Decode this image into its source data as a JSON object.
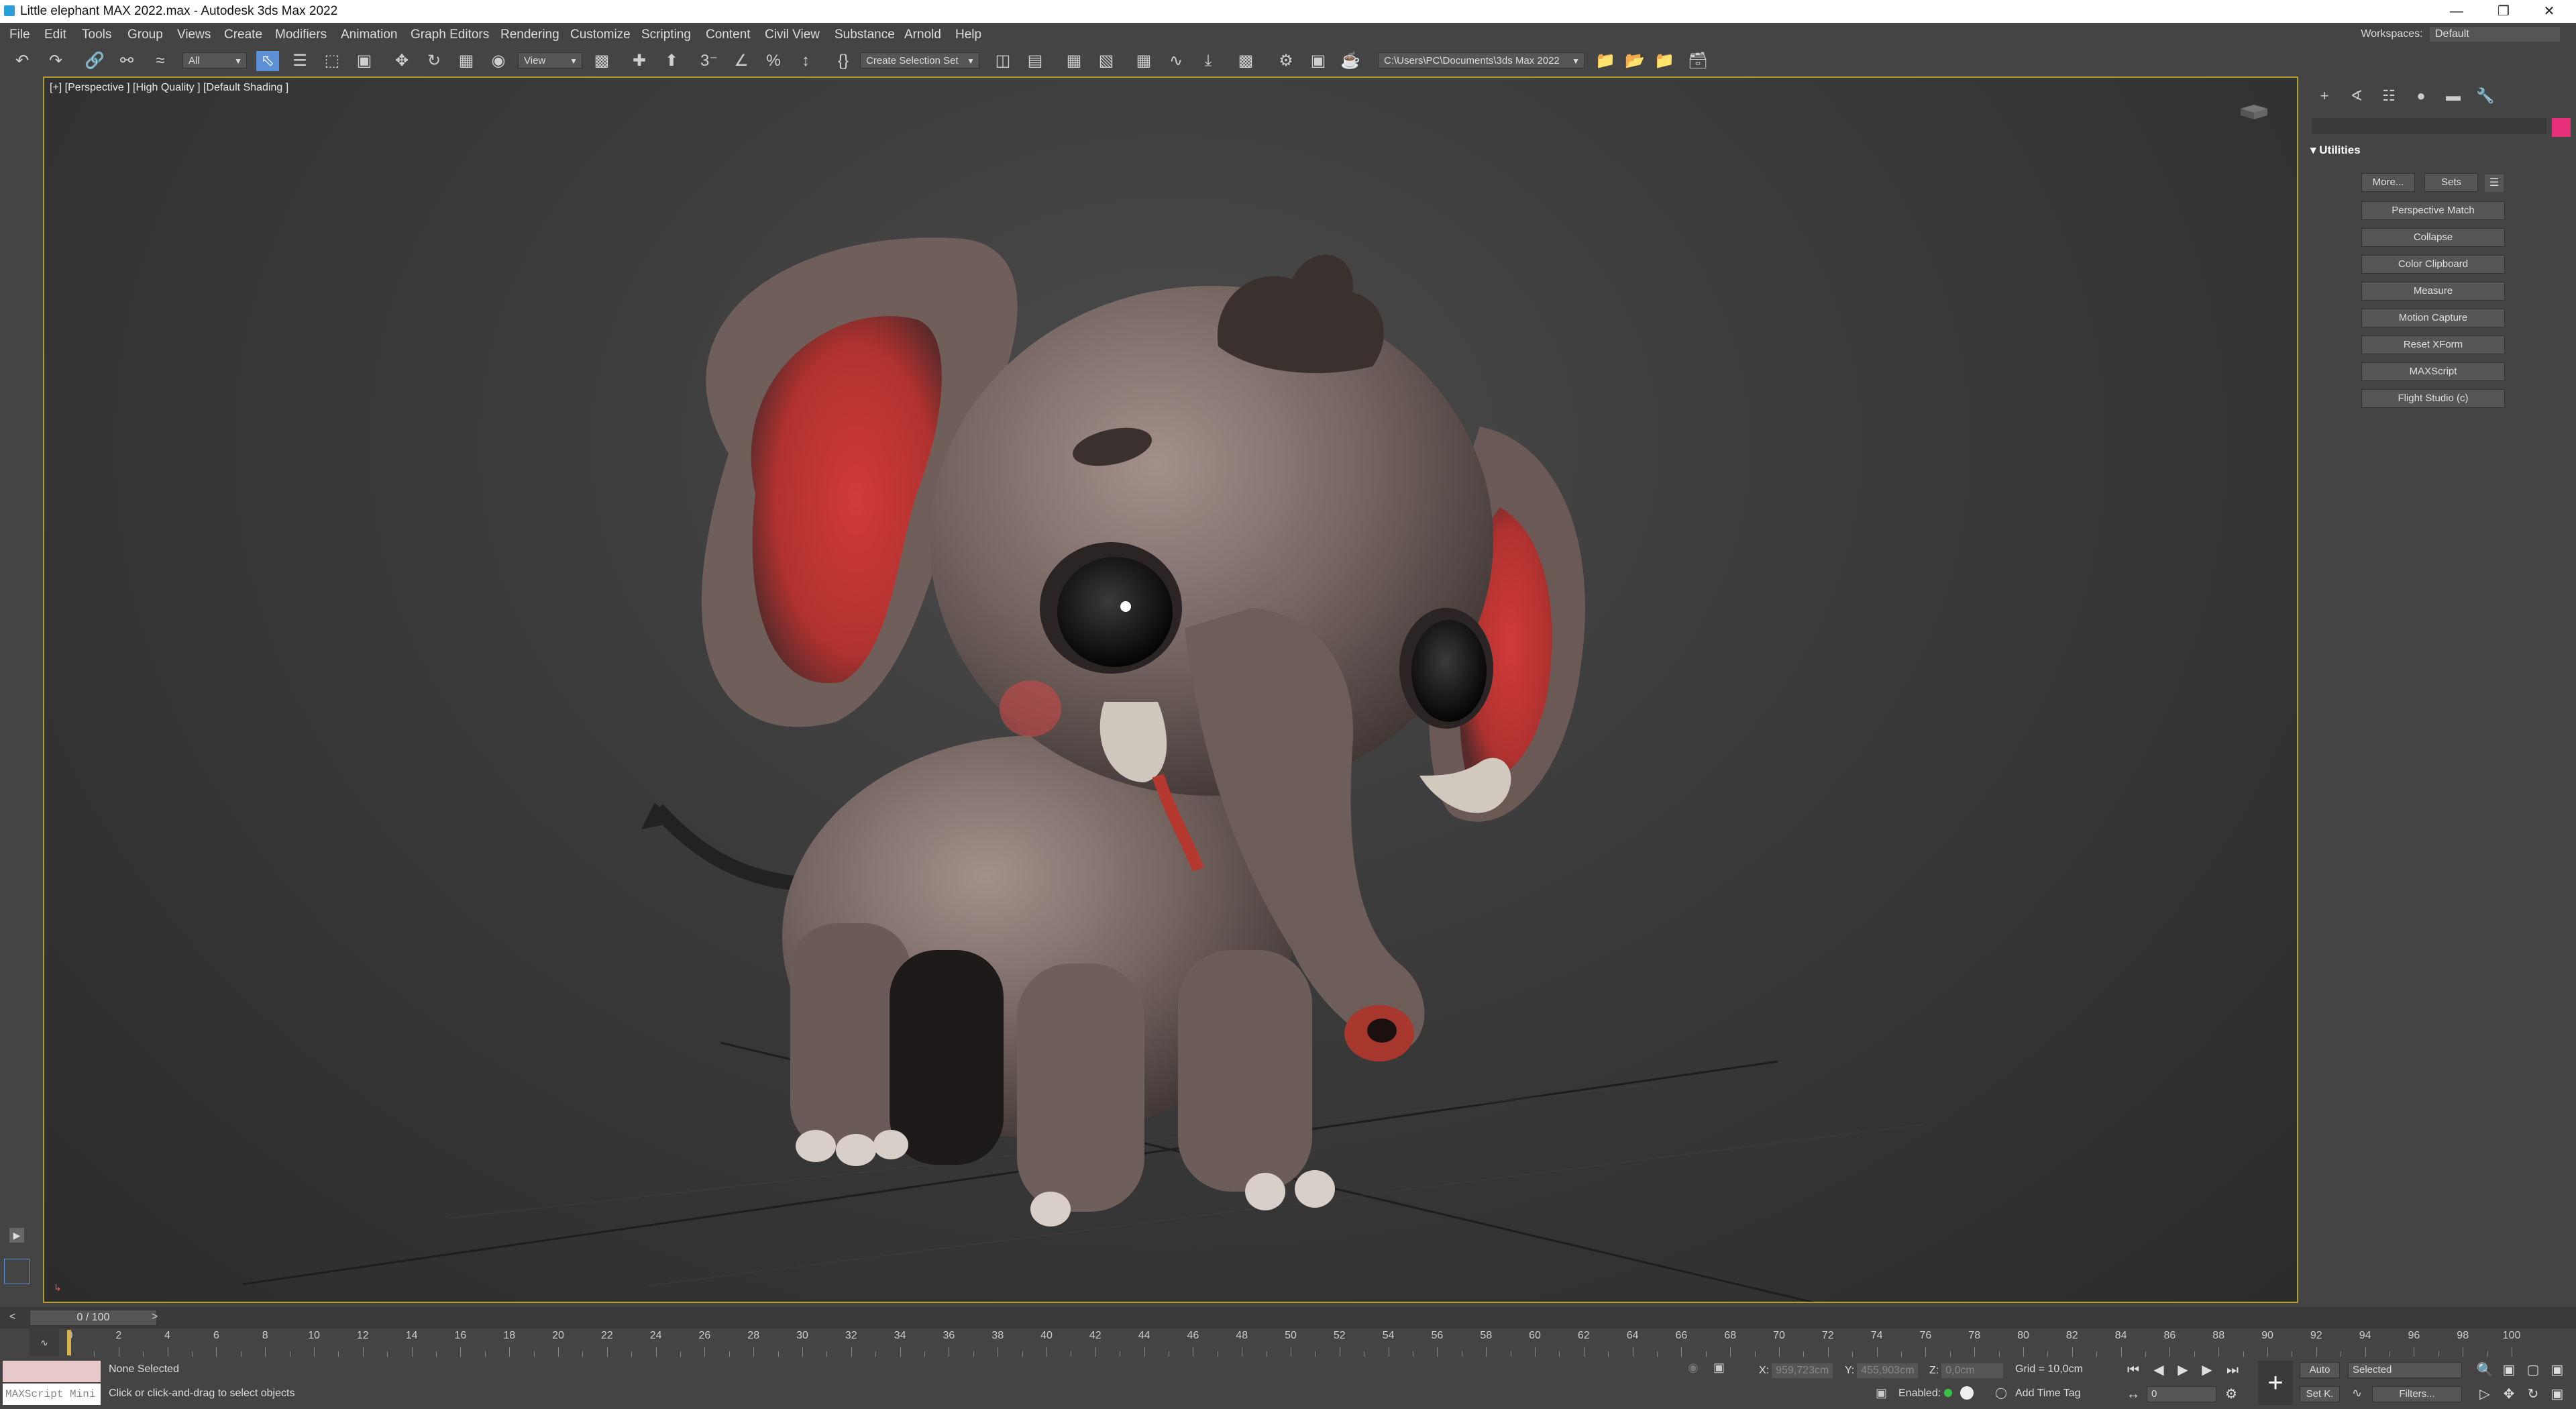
{
  "window": {
    "title": "Little elephant MAX 2022.max - Autodesk 3ds Max 2022"
  },
  "menu": [
    "File",
    "Edit",
    "Tools",
    "Group",
    "Views",
    "Create",
    "Modifiers",
    "Animation",
    "Graph Editors",
    "Rendering",
    "Customize",
    "Scripting",
    "Content",
    "Civil View",
    "Substance",
    "Arnold",
    "Help"
  ],
  "workspaces": {
    "label": "Workspaces:",
    "value": "Default"
  },
  "toolbar": {
    "filter_value": "All",
    "refcoord_value": "View",
    "selection_set_placeholder": "Create Selection Set",
    "project_path": "C:\\Users\\PC\\Documents\\3ds Max 2022"
  },
  "viewport": {
    "label": "[+] [Perspective ] [High Quality ] [Default Shading ]"
  },
  "command_panel": {
    "rollout_title": "Utilities",
    "more_button": "More...",
    "sets_button": "Sets",
    "utilities": [
      "Perspective Match",
      "Collapse",
      "Color Clipboard",
      "Measure",
      "Motion Capture",
      "Reset XForm",
      "MAXScript",
      "Flight Studio (c)"
    ]
  },
  "timeline": {
    "slider_text": "0 / 100",
    "ticks": [
      "0",
      "2",
      "4",
      "6",
      "8",
      "10",
      "12",
      "14",
      "16",
      "18",
      "20",
      "22",
      "24",
      "26",
      "28",
      "30",
      "32",
      "34",
      "36",
      "38",
      "40",
      "42",
      "44",
      "46",
      "48",
      "50",
      "52",
      "54",
      "56",
      "58",
      "60",
      "62",
      "64",
      "66",
      "68",
      "70",
      "72",
      "74",
      "76",
      "78",
      "80",
      "82",
      "84",
      "86",
      "88",
      "90",
      "92",
      "94",
      "96",
      "98",
      "100"
    ]
  },
  "status": {
    "selection": "None Selected",
    "prompt": "Click or click-and-drag to select objects",
    "maxscript_placeholder": "MAXScript Mini",
    "x_label": "X:",
    "x_value": "959,723cm",
    "y_label": "Y:",
    "y_value": "455,903cm",
    "z_label": "Z:",
    "z_value": "0,0cm",
    "grid": "Grid = 10,0cm",
    "enabled_label": "Enabled:",
    "add_time_tag": "Add Time Tag",
    "auto_key": "Auto",
    "set_key": "Set K.",
    "key_filter": "Selected",
    "filters": "Filters...",
    "frame": "0"
  },
  "colors": {
    "accent": "#5b8fd6",
    "viewport_border": "#b29b2e",
    "command_swatch": "#e6307a"
  }
}
